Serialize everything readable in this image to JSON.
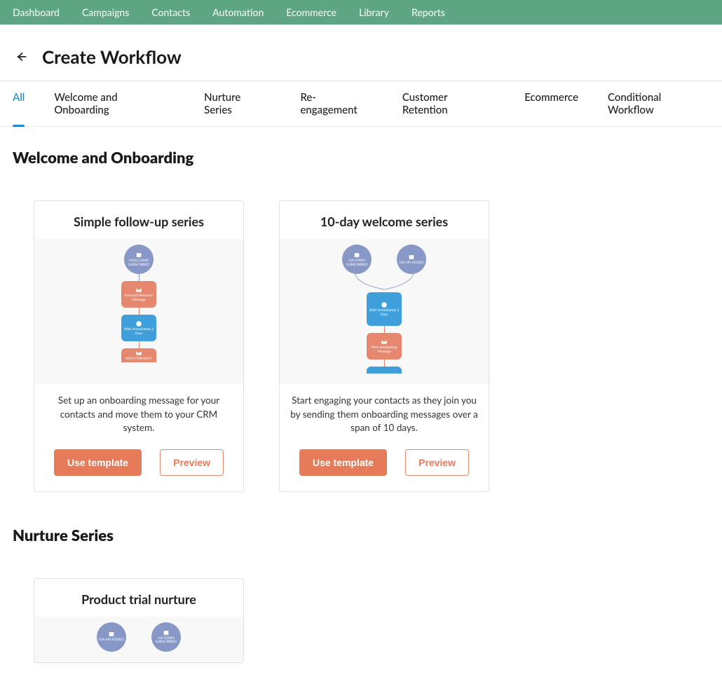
{
  "topnav": {
    "items": [
      "Dashboard",
      "Campaigns",
      "Contacts",
      "Automation",
      "Ecommerce",
      "Library",
      "Reports"
    ]
  },
  "header": {
    "title": "Create Workflow"
  },
  "tabs": [
    {
      "label": "All",
      "active": true
    },
    {
      "label": "Welcome and Onboarding",
      "active": false
    },
    {
      "label": "Nurture Series",
      "active": false
    },
    {
      "label": "Re-engagement",
      "active": false
    },
    {
      "label": "Customer Retention",
      "active": false
    },
    {
      "label": "Ecommerce",
      "active": false
    },
    {
      "label": "Conditional Workflow",
      "active": false
    }
  ],
  "buttons": {
    "use_template": "Use template",
    "preview": "Preview"
  },
  "sections": [
    {
      "title": "Welcome and Onboarding",
      "cards": [
        {
          "title": "Simple follow-up series",
          "desc": "Set up an onboarding message for your contacts and move them to your CRM system."
        },
        {
          "title": "10-day welcome series",
          "desc": "Start engaging your contacts as they join you by sending them onboarding messages over a span of 10 days."
        }
      ]
    },
    {
      "title": "Nurture Series",
      "cards": [
        {
          "title": "Product trial nurture"
        }
      ]
    }
  ],
  "nodes": {
    "mailchimp_subscribed": "MAILCHIMP SUBSCRIBED",
    "via_form_subscribed": "VIA FORM SUBSCRIBED",
    "via_api_added": "VIA API ADDED",
    "forward_welcome_message": "Forward Welcome Message",
    "wait_3_days": "Wait Immediately 3 Days",
    "wait_for_next": "WAIT FOR NEXT",
    "post_onboarding_message": "Post-onboarding Message"
  },
  "colors": {
    "nav_bg": "#5ea584",
    "accent_blue": "#1f88c9",
    "btn_primary": "#e67b5a",
    "node_circle": "#8797c6",
    "node_orange": "#e6886f",
    "node_blue": "#3e9fdb"
  }
}
